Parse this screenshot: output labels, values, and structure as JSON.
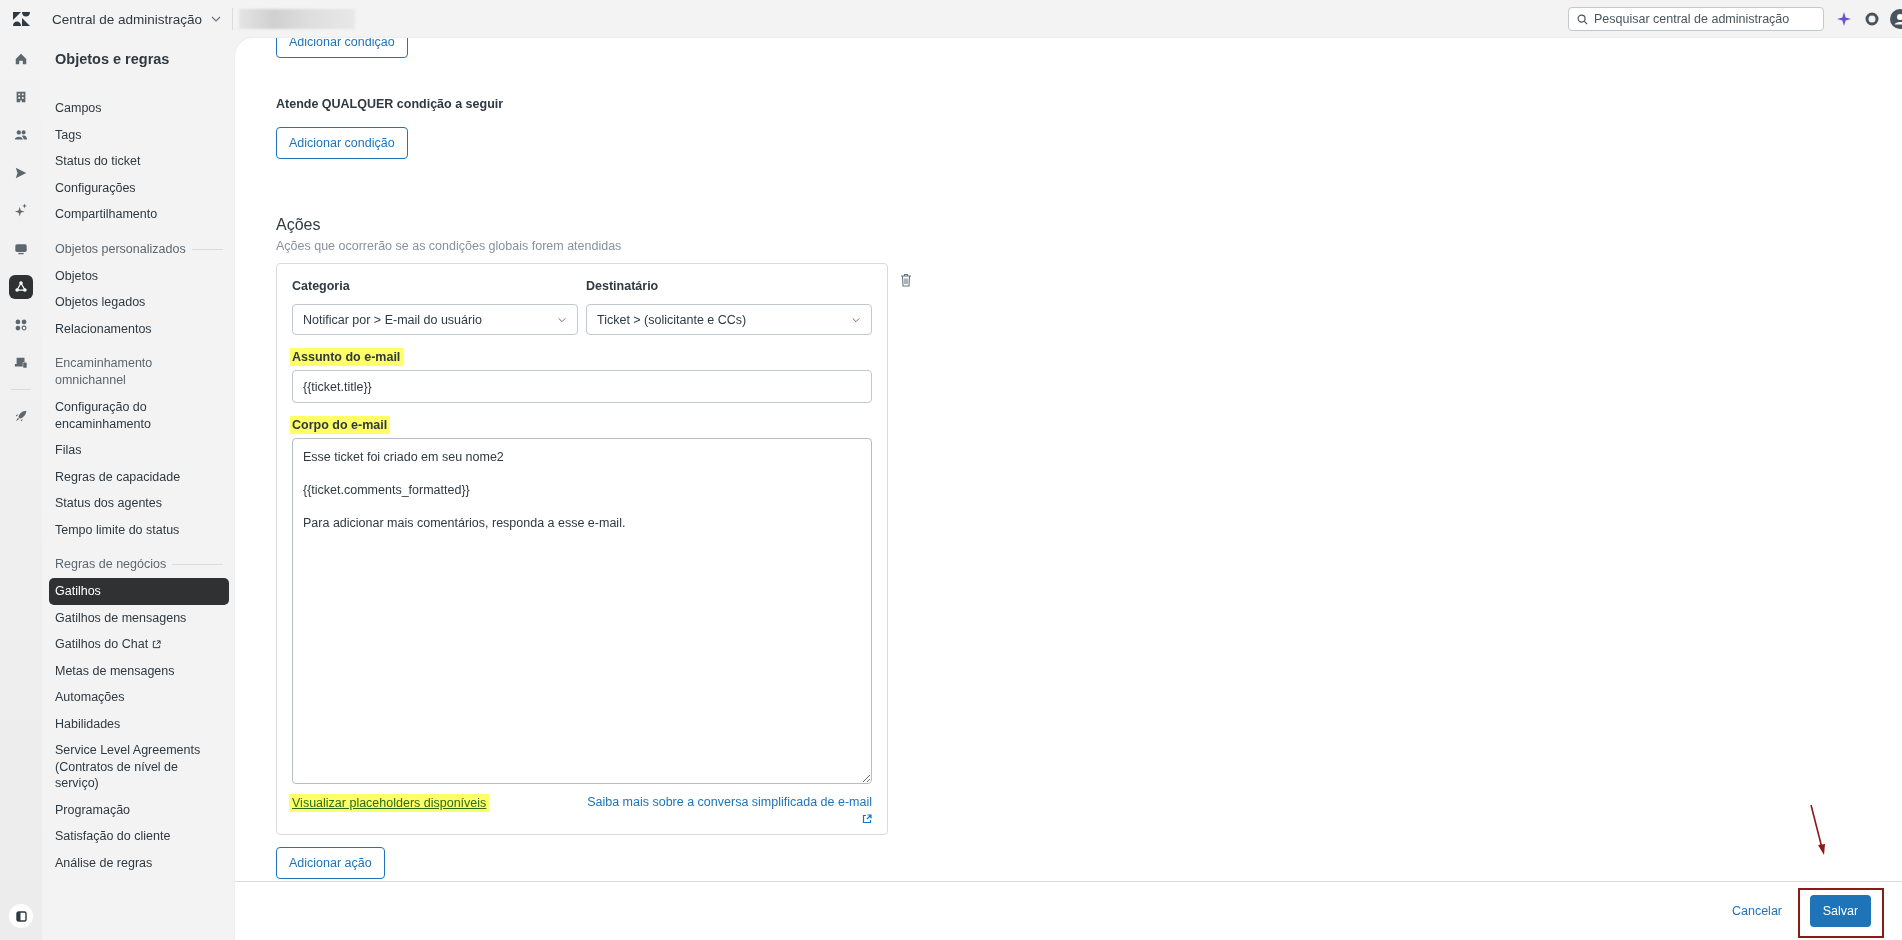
{
  "topbar": {
    "product": "Central de administração",
    "search": {
      "placeholder": "Pesquisar central de administração"
    }
  },
  "rail_primary": [
    {
      "kind": "home",
      "selected": false
    },
    {
      "kind": "building",
      "selected": false
    },
    {
      "kind": "people",
      "selected": false
    },
    {
      "kind": "send",
      "selected": false
    },
    {
      "kind": "sparkle",
      "selected": false
    },
    {
      "kind": "monitor",
      "selected": false
    },
    {
      "kind": "objects",
      "selected": true
    },
    {
      "kind": "apps",
      "selected": false
    },
    {
      "kind": "device",
      "selected": false
    }
  ],
  "rail_secondary": [
    {
      "kind": "rocket",
      "selected": false
    }
  ],
  "sidebar": {
    "title": "Objetos e regras",
    "sections": [
      {
        "items": [
          {
            "label": "Campos",
            "selected": false,
            "external": false
          },
          {
            "label": "Tags",
            "selected": false,
            "external": false
          },
          {
            "label": "Status do ticket",
            "selected": false,
            "external": false
          },
          {
            "label": "Configurações",
            "selected": false,
            "external": false
          },
          {
            "label": "Compartilhamento",
            "selected": false,
            "external": false
          }
        ]
      },
      {
        "heading": "Objetos personalizados",
        "items": [
          {
            "label": "Objetos",
            "selected": false,
            "external": false
          },
          {
            "label": "Objetos legados",
            "selected": false,
            "external": false
          },
          {
            "label": "Relacionamentos",
            "selected": false,
            "external": false
          }
        ]
      },
      {
        "heading": "Encaminhamento omnichannel",
        "items": [
          {
            "label": "Configuração do encaminhamento",
            "selected": false,
            "external": false
          },
          {
            "label": "Filas",
            "selected": false,
            "external": false
          },
          {
            "label": "Regras de capacidade",
            "selected": false,
            "external": false
          },
          {
            "label": "Status dos agentes",
            "selected": false,
            "external": false
          },
          {
            "label": "Tempo limite do status",
            "selected": false,
            "external": false
          }
        ]
      },
      {
        "heading": "Regras de negócios",
        "items": [
          {
            "label": "Gatilhos",
            "selected": true,
            "external": false
          },
          {
            "label": "Gatilhos de mensagens",
            "selected": false,
            "external": false
          },
          {
            "label": "Gatilhos do Chat",
            "selected": false,
            "external": true
          },
          {
            "label": "Metas de mensagens",
            "selected": false,
            "external": false
          },
          {
            "label": "Automações",
            "selected": false,
            "external": false
          },
          {
            "label": "Habilidades",
            "selected": false,
            "external": false
          },
          {
            "label": "Service Level Agreements (Contratos de nível de serviço)",
            "selected": false,
            "external": false
          },
          {
            "label": "Programação",
            "selected": false,
            "external": false
          },
          {
            "label": "Satisfação do cliente",
            "selected": false,
            "external": false
          },
          {
            "label": "Análise de regras",
            "selected": false,
            "external": false
          }
        ]
      }
    ]
  },
  "conditions_all": {
    "add_button": "Adicionar condição"
  },
  "conditions_any": {
    "label": "Atende QUALQUER condição a seguir",
    "add_button": "Adicionar condição"
  },
  "actions": {
    "title": "Ações",
    "subtitle": "Ações que ocorrerão se as condições globais forem atendidas",
    "action": {
      "category": {
        "label": "Categoria",
        "value": "Notificar por > E-mail do usuário"
      },
      "recipient": {
        "label": "Destinatário",
        "value": "Ticket > (solicitante e CCs)"
      },
      "subject": {
        "label": "Assunto do e-mail",
        "highlighted": true,
        "value": "{{ticket.title}}"
      },
      "body": {
        "label": "Corpo do e-mail",
        "highlighted": true,
        "value": "Esse ticket foi criado em seu nome2\n\n{{ticket.comments_formatted}}\n\nPara adicionar mais comentários, responda a esse e-mail."
      },
      "placeholders_link": {
        "text": "Visualizar placeholders disponíveis",
        "highlighted": true
      },
      "learn_more_link": "Saiba mais sobre a conversa simplificada de e-mail"
    },
    "add_button": "Adicionar ação"
  },
  "footer": {
    "cancel": "Cancelar",
    "save": {
      "label": "Salvar",
      "annotated": true
    }
  }
}
